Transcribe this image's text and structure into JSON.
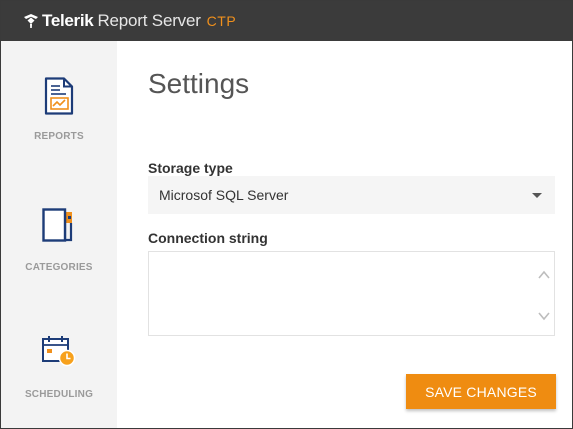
{
  "header": {
    "brand": "Telerik",
    "product": "Report Server",
    "edition": "CTP"
  },
  "sidebar": {
    "items": [
      {
        "label": "REPORTS",
        "icon": "report-document-icon"
      },
      {
        "label": "CATEGORIES",
        "icon": "categories-folder-icon"
      },
      {
        "label": "SCHEDULING",
        "icon": "calendar-clock-icon"
      }
    ]
  },
  "main": {
    "title": "Settings",
    "storage": {
      "label": "Storage type",
      "value": "Microsof SQL Server"
    },
    "connection": {
      "label": "Connection string",
      "value": ""
    },
    "save_label": "SAVE CHANGES"
  },
  "colors": {
    "titlebar": "#3b3b3b",
    "accent": "#ef8c11",
    "icon_blue": "#1d3c78",
    "sidebar_bg": "#f3f3f3"
  }
}
